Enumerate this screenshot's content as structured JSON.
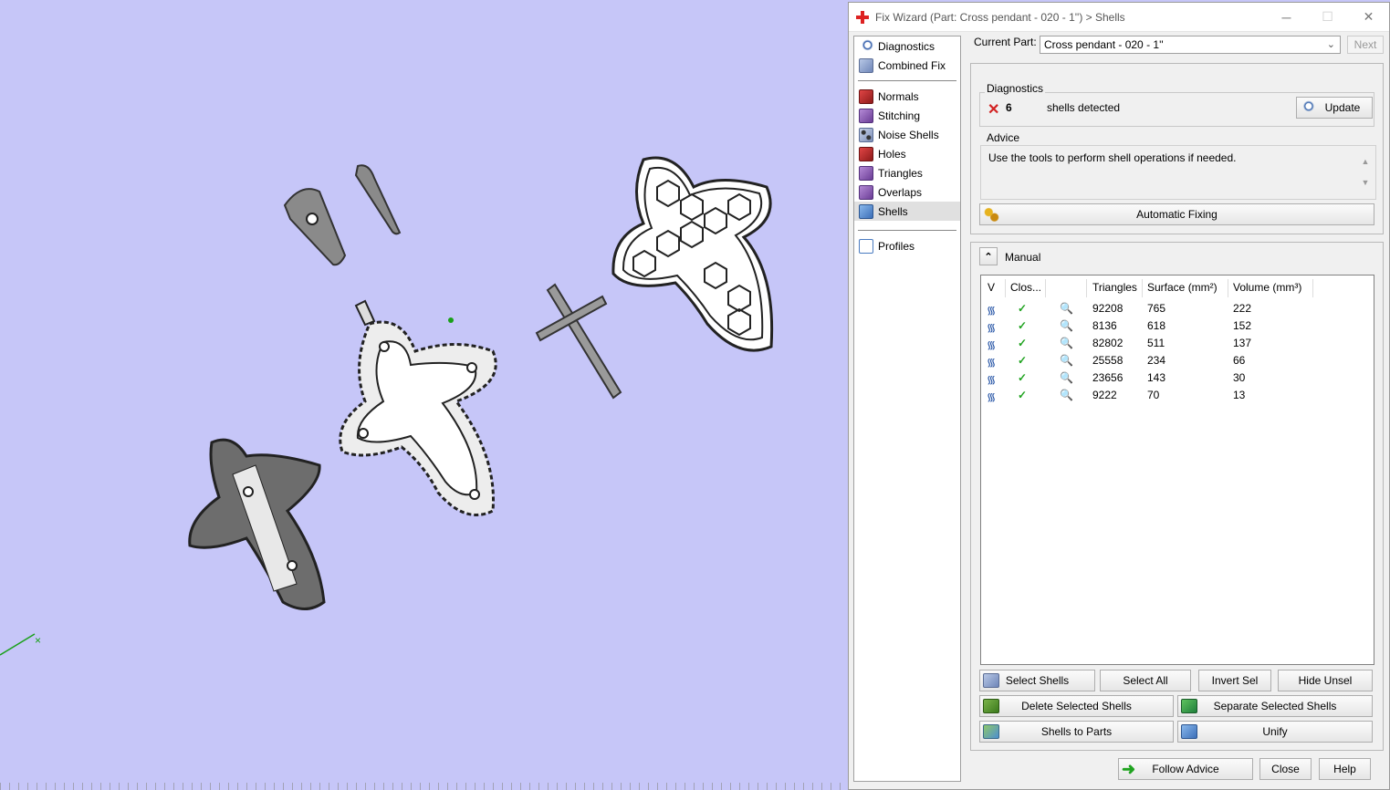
{
  "window": {
    "title": "Fix Wizard (Part: Cross  pendant  - 020 - 1'') > Shells",
    "minimize": "─",
    "maximize": "☐",
    "close": "✕"
  },
  "nav": {
    "items_top": [
      {
        "label": "Diagnostics",
        "icon": "diagnostics-icon"
      },
      {
        "label": "Combined Fix",
        "icon": "combined-fix-icon"
      }
    ],
    "items_fix": [
      {
        "label": "Normals",
        "icon": "normals-icon"
      },
      {
        "label": "Stitching",
        "icon": "stitching-icon"
      },
      {
        "label": "Noise Shells",
        "icon": "noise-shells-icon"
      },
      {
        "label": "Holes",
        "icon": "holes-icon"
      },
      {
        "label": "Triangles",
        "icon": "triangles-icon"
      },
      {
        "label": "Overlaps",
        "icon": "overlaps-icon"
      },
      {
        "label": "Shells",
        "icon": "shells-icon",
        "selected": true
      }
    ],
    "items_bottom": [
      {
        "label": "Profiles",
        "icon": "profiles-icon"
      }
    ]
  },
  "current_part": {
    "label": "Current Part:",
    "value": "Cross  pendant  - 020 - 1''",
    "next": "Next"
  },
  "diagnostics": {
    "title": "Diagnostics",
    "count": "6",
    "status": "shells detected",
    "update": "Update"
  },
  "advice": {
    "title": "Advice",
    "text": "Use the tools to perform shell operations if needed.",
    "automatic_fixing": "Automatic Fixing"
  },
  "manual": {
    "title": "Manual",
    "columns": [
      "V",
      "Clos...",
      "",
      "Triangles",
      "Surface (mm²)",
      "Volume (mm³)"
    ],
    "rows": [
      {
        "triangles": "92208",
        "surface": "765",
        "volume": "222"
      },
      {
        "triangles": "8136",
        "surface": "618",
        "volume": "152"
      },
      {
        "triangles": "82802",
        "surface": "511",
        "volume": "137"
      },
      {
        "triangles": "25558",
        "surface": "234",
        "volume": "66"
      },
      {
        "triangles": "23656",
        "surface": "143",
        "volume": "30"
      },
      {
        "triangles": "9222",
        "surface": "70",
        "volume": "13"
      }
    ],
    "buttons": {
      "select_shells": "Select Shells",
      "select_all": "Select All",
      "invert_sel": "Invert Sel",
      "hide_unsel": "Hide Unsel",
      "delete_selected": "Delete Selected Shells",
      "separate_selected": "Separate Selected Shells",
      "shells_to_parts": "Shells to Parts",
      "unify": "Unify"
    }
  },
  "footer": {
    "follow_advice": "Follow Advice",
    "close": "Close",
    "help": "Help"
  },
  "colors": {
    "viewport_bg": "#c6c6f8",
    "check": "#1fa31f",
    "error": "#d22222"
  }
}
